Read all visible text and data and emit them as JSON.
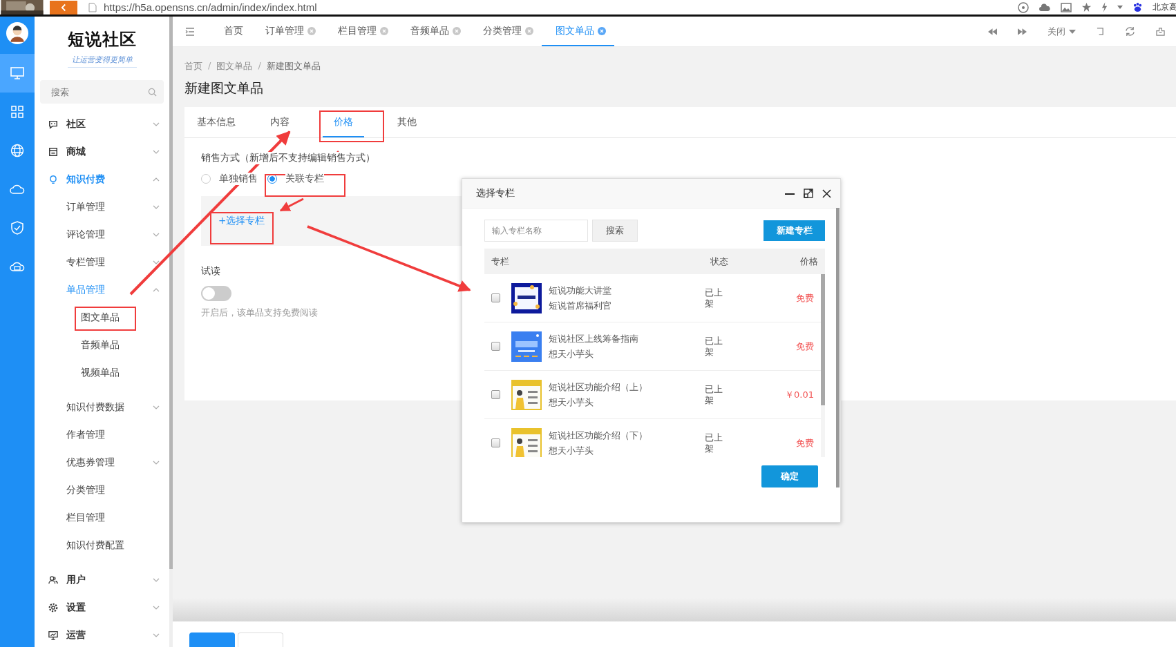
{
  "browser": {
    "url": "https://h5a.opensns.cn/admin/index/index.html",
    "right_text": "北京高"
  },
  "rail": [
    {
      "kind": "monitor",
      "selected": true
    },
    {
      "kind": "grid",
      "selected": false
    },
    {
      "kind": "globe",
      "selected": false
    },
    {
      "kind": "cloud",
      "selected": false
    },
    {
      "kind": "shield",
      "selected": false
    },
    {
      "kind": "disk",
      "selected": false
    }
  ],
  "brand": {
    "name": "短说社区",
    "slogan": "让运营变得更简单"
  },
  "sidebar": {
    "search_placeholder": "搜索",
    "items": [
      {
        "label": "社区",
        "kind": "chat",
        "expanded": false,
        "selected": false
      },
      {
        "label": "商城",
        "kind": "store",
        "expanded": false,
        "selected": false
      },
      {
        "label": "知识付费",
        "kind": "bulb",
        "expanded": true,
        "selected": true,
        "children": [
          {
            "label": "订单管理",
            "expanded": false,
            "selected": false
          },
          {
            "label": "评论管理",
            "expanded": false,
            "selected": false
          },
          {
            "label": "专栏管理",
            "expanded": false,
            "selected": false
          },
          {
            "label": "单品管理",
            "expanded": true,
            "selected": true,
            "children": [
              {
                "label": "图文单品",
                "selected": false
              },
              {
                "label": "音频单品",
                "selected": false
              },
              {
                "label": "视频单品",
                "selected": false
              }
            ]
          },
          {
            "label": "知识付费数据",
            "expanded": false,
            "selected": false
          },
          {
            "label": "作者管理",
            "selected": false
          },
          {
            "label": "优惠券管理",
            "expanded": false,
            "selected": false
          },
          {
            "label": "分类管理",
            "selected": false
          },
          {
            "label": "栏目管理",
            "selected": false
          },
          {
            "label": "知识付费配置",
            "selected": false
          }
        ]
      },
      {
        "label": "用户",
        "kind": "user",
        "expanded": false,
        "selected": false
      },
      {
        "label": "设置",
        "kind": "gear",
        "expanded": false,
        "selected": false
      },
      {
        "label": "运营",
        "kind": "board",
        "expanded": false,
        "selected": false
      }
    ]
  },
  "tabs": [
    {
      "label": "首页",
      "closable": false,
      "selected": false
    },
    {
      "label": "订单管理",
      "closable": true,
      "selected": false
    },
    {
      "label": "栏目管理",
      "closable": true,
      "selected": false
    },
    {
      "label": "音频单品",
      "closable": true,
      "selected": false
    },
    {
      "label": "分类管理",
      "closable": true,
      "selected": false
    },
    {
      "label": "图文单品",
      "closable": true,
      "selected": true
    }
  ],
  "tab_tools": {
    "close_menu": "关闭"
  },
  "breadcrumb": [
    "首页",
    "/",
    "图文单品",
    "/",
    "新建图文单品"
  ],
  "page_title": "新建图文单品",
  "form_tabs": [
    {
      "label": "基本信息",
      "selected": false
    },
    {
      "label": "内容",
      "selected": false
    },
    {
      "label": "价格",
      "selected": true
    },
    {
      "label": "其他",
      "selected": false
    }
  ],
  "sale_mode": {
    "label": "销售方式（新增后不支持编辑销售方式）",
    "options": [
      {
        "label": "单独销售",
        "selected": false
      },
      {
        "label": "关联专栏",
        "selected": true
      }
    ],
    "link": "+选择专栏"
  },
  "trial": {
    "label": "试读",
    "on": false,
    "hint": "开启后，该单品支持免费阅读"
  },
  "dialog": {
    "title": "选择专栏",
    "search_placeholder": "输入专栏名称",
    "search_button": "搜索",
    "new_button": "新建专栏",
    "columns": [
      "专栏",
      "状态",
      "价格"
    ],
    "rows": [
      {
        "checked": false,
        "title": "短说功能大讲堂",
        "author": "短说首席福利官",
        "status": "已上架",
        "price": "免费"
      },
      {
        "checked": false,
        "title": "短说社区上线筹备指南",
        "author": "想天小芋头",
        "status": "已上架",
        "price": "免费"
      },
      {
        "checked": false,
        "title": "短说社区功能介绍（上）",
        "author": "想天小芋头",
        "status": "已上架",
        "price": "￥0.01"
      },
      {
        "checked": false,
        "title": "短说社区功能介绍（下）",
        "author": "想天小芋头",
        "status": "已上架",
        "price": "免费"
      }
    ],
    "confirm_button": "确定"
  }
}
